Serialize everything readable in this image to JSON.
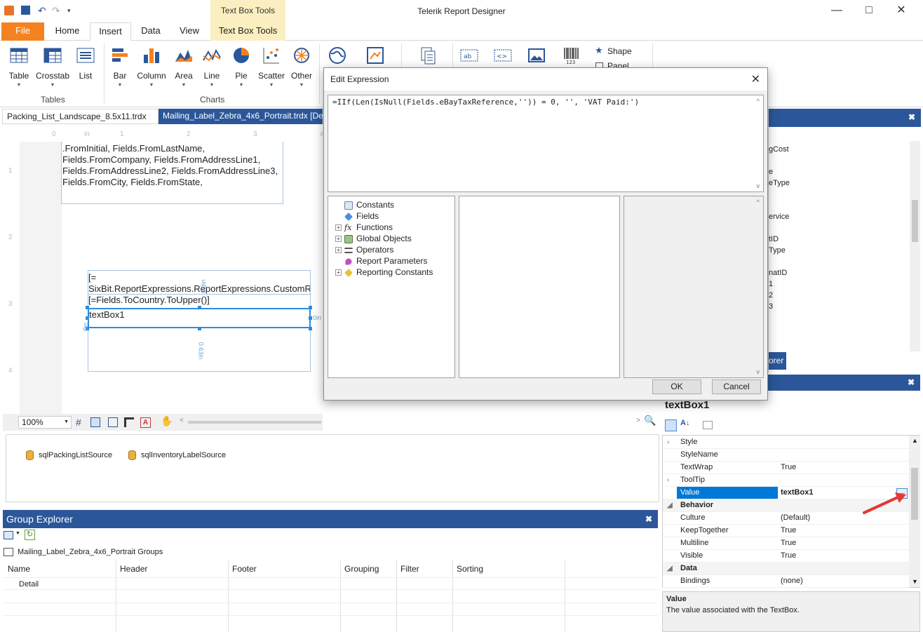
{
  "window": {
    "title": "Telerik Report Designer"
  },
  "ribbon": {
    "context_group_label": "Text Box Tools",
    "tabs": [
      "File",
      "Home",
      "Insert",
      "Data",
      "View",
      "Text Box Tools"
    ],
    "buttons": {
      "table": "Table",
      "crosstab": "Crosstab",
      "list": "List",
      "bar": "Bar",
      "column": "Column",
      "area": "Area",
      "line": "Line",
      "pie": "Pie",
      "scatter": "Scatter",
      "other": "Other",
      "shape": "Shape",
      "panel": "Panel"
    },
    "groups": {
      "tables": "Tables",
      "charts": "Charts"
    }
  },
  "doc_tabs": [
    "Packing_List_Landscape_8.5x11.trdx",
    "Mailing_Label_Zebra_4x6_Portrait.trdx [Desi"
  ],
  "ruler": {
    "h": [
      "0",
      "in",
      "1",
      "2",
      "3",
      "4"
    ],
    "v": [
      "1",
      "2",
      "3",
      "4"
    ]
  },
  "design": {
    "from_address": ".FromInitial, Fields.FromLastName, Fields.FromCompany, Fields.FromAddressLine1, Fields.FromAddressLine2, Fields.FromAddressLine3, Fields.FromCity, Fields.FromState, Fields.FromPostalCode)]",
    "custom_expr": "[= SixBit.ReportExpressions.ReportExpressions.CustomReportExpresssions.GetFormattedAddress(Fields.",
    "to_country": "[=Fields.ToCountry.ToUpper()]",
    "textbox": "textBox1",
    "dim_a": "0.3in",
    "dim_b": "0.63in",
    "dim_c": "0in",
    "dim_d": "0in"
  },
  "zoom": {
    "value": "100%"
  },
  "datasources": [
    "sqlPackingListSource",
    "sqlInventoryLabelSource"
  ],
  "group_explorer": {
    "title": "Group Explorer",
    "groups_label": "Mailing_Label_Zebra_4x6_Portrait Groups",
    "columns": [
      "Name",
      "Header",
      "Footer",
      "Grouping",
      "Filter",
      "Sorting"
    ],
    "rows": [
      "Detail"
    ]
  },
  "right_top_panel": {
    "items": [
      "gCost",
      "e",
      "eType",
      "ervice",
      "tID",
      "Type",
      "natID",
      "1",
      "2",
      "3"
    ],
    "button": "orer"
  },
  "properties": {
    "object_name": "textBox1",
    "rows": [
      {
        "name": "Style",
        "value": "",
        "expand": true
      },
      {
        "name": "StyleName",
        "value": ""
      },
      {
        "name": "TextWrap",
        "value": "True"
      },
      {
        "name": "ToolTip",
        "value": "",
        "expand": true
      },
      {
        "name": "Value",
        "value": "textBox1",
        "selected": true
      },
      {
        "name": "Behavior",
        "category": true
      },
      {
        "name": "Culture",
        "value": "(Default)"
      },
      {
        "name": "KeepTogether",
        "value": "True"
      },
      {
        "name": "Multiline",
        "value": "True"
      },
      {
        "name": "Visible",
        "value": "True"
      },
      {
        "name": "Data",
        "category": true
      },
      {
        "name": "Bindings",
        "value": "(none)"
      }
    ],
    "ellipsis": "...",
    "desc_title": "Value",
    "desc_text": "The value associated with the TextBox."
  },
  "dialog": {
    "title": "Edit Expression",
    "expression": "=IIf(Len(IsNull(Fields.eBayTaxReference,'')) = 0, '', 'VAT Paid:')",
    "tree": [
      "Constants",
      "Fields",
      "Functions",
      "Global Objects",
      "Operators",
      "Report Parameters",
      "Reporting Constants"
    ],
    "ok": "OK",
    "cancel": "Cancel"
  },
  "colors": {
    "accent": "#2b579a",
    "file_tab": "#f58220",
    "selection": "#0078d7",
    "context_tab": "#fbeec0"
  }
}
